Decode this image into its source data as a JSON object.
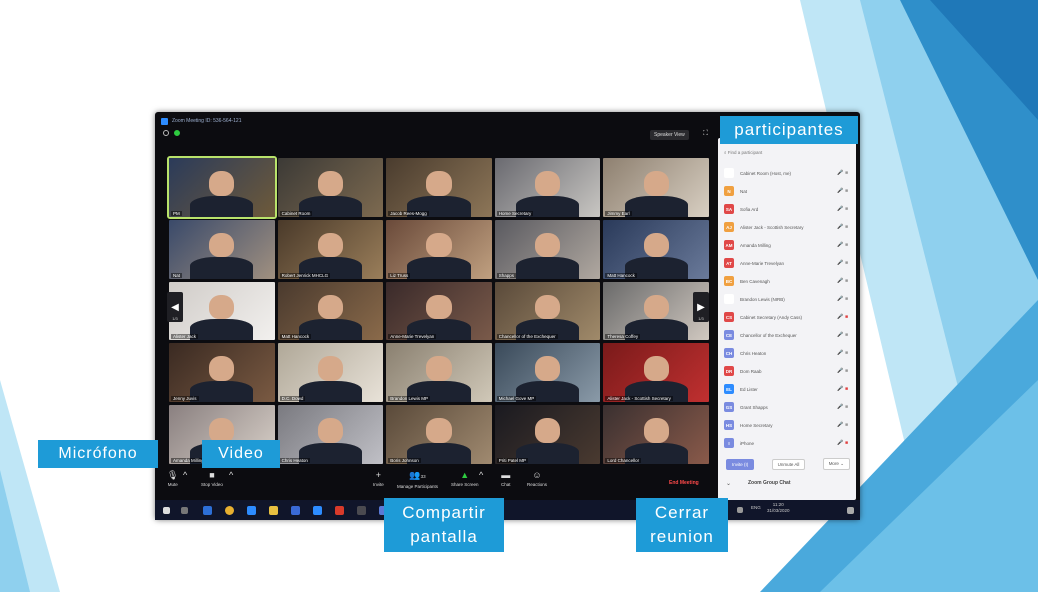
{
  "window": {
    "title": "Zoom Meeting ID: 536-564-121",
    "speaker_view_label": "Speaker View"
  },
  "grid": {
    "tiles": [
      {
        "name": "PM",
        "colors": [
          "#2b3b5a",
          "#6e5a3a"
        ]
      },
      {
        "name": "Cabinet Room",
        "colors": [
          "#3c3a36",
          "#7d6a50"
        ]
      },
      {
        "name": "Jacob Rees-Mogg",
        "colors": [
          "#4a3c2e",
          "#8d7658"
        ]
      },
      {
        "name": "Home Secretary",
        "colors": [
          "#6a6a70",
          "#c8c6c2"
        ]
      },
      {
        "name": "Jimmy Earl",
        "colors": [
          "#8e8070",
          "#d8cfc2"
        ]
      },
      {
        "name": "Nat",
        "colors": [
          "#3a4a6a",
          "#a09080"
        ]
      },
      {
        "name": "Robert Jenrick MHCLG",
        "colors": [
          "#4a3a2a",
          "#9a7e5a"
        ]
      },
      {
        "name": "Liz Truss",
        "colors": [
          "#6a4a3a",
          "#c0a080"
        ]
      },
      {
        "name": "Shapps",
        "colors": [
          "#5a5a60",
          "#b0a8a0"
        ]
      },
      {
        "name": "Matt Hancock",
        "colors": [
          "#2a3a5a",
          "#6a7a9a"
        ]
      },
      {
        "name": "Alister Jack",
        "colors": [
          "#d0ccc8",
          "#f2f0ee"
        ]
      },
      {
        "name": "Matt Hancock",
        "colors": [
          "#4a3a2e",
          "#8a6a4a"
        ]
      },
      {
        "name": "Anne-Marie Trevelyan",
        "colors": [
          "#3a2a2a",
          "#7a5a4a"
        ]
      },
      {
        "name": "Chancellor of the Exchequer",
        "colors": [
          "#5a4a3a",
          "#a08a6a"
        ]
      },
      {
        "name": "Theresa Coffey",
        "colors": [
          "#6a6a6a",
          "#d0c8c0"
        ]
      },
      {
        "name": "Jenny Juvis",
        "colors": [
          "#3a2a22",
          "#7a5a42"
        ]
      },
      {
        "name": "D.C. Dowd",
        "colors": [
          "#b0a898",
          "#e8e2d8"
        ]
      },
      {
        "name": "Brandon Lewis MP",
        "colors": [
          "#8a8070",
          "#d0c8b8"
        ]
      },
      {
        "name": "Michael Gove MP",
        "colors": [
          "#3a4a5a",
          "#8a9aa8"
        ]
      },
      {
        "name": "Alister Jack - Scottish Secretary",
        "colors": [
          "#7a1a1a",
          "#c03030"
        ]
      },
      {
        "name": "Amanda Milling",
        "colors": [
          "#8a8080",
          "#d8d0c8"
        ]
      },
      {
        "name": "Chris Heaton",
        "colors": [
          "#7a7a80",
          "#c0c0c6"
        ]
      },
      {
        "name": "Boris Johnson",
        "colors": [
          "#5a4a3a",
          "#a08a70"
        ]
      },
      {
        "name": "Priti Patel MP",
        "colors": [
          "#1a1a20",
          "#4a3a30"
        ]
      },
      {
        "name": "Lord Chancellor",
        "colors": [
          "#3a3030",
          "#8a5a4a"
        ]
      }
    ]
  },
  "nav": {
    "prev_page": "1/3",
    "next_page": "1/3"
  },
  "toolbar": {
    "mute": "Mute",
    "stop_video": "Stop Video",
    "invite": "Invite",
    "participants_count": "33",
    "manage_participants": "Manage Participants",
    "share_screen": "Share Screen",
    "chat": "Chat",
    "reactions": "Reactions",
    "end_meeting": "End Meeting"
  },
  "clock": {
    "time": "11:20",
    "date": "31/03/2020",
    "lang": "ENG"
  },
  "panel": {
    "search_placeholder": "Find a participant",
    "participants": [
      {
        "initials": "",
        "name": "Cabinet Room (Host, me)",
        "color": "#ffffff",
        "muted": false
      },
      {
        "initials": "N",
        "name": "Nat",
        "color": "#f0a040",
        "muted": false
      },
      {
        "initials": "SA",
        "name": "Sofia Ard",
        "color": "#e04848",
        "muted": false
      },
      {
        "initials": "AJ",
        "name": "Alister Jack - Scottish Secretary",
        "color": "#f0a040",
        "muted": false
      },
      {
        "initials": "AM",
        "name": "Amanda Milling",
        "color": "#e04848",
        "muted": false
      },
      {
        "initials": "AT",
        "name": "Anne-Marie Trevelyan",
        "color": "#e04848",
        "muted": false
      },
      {
        "initials": "BC",
        "name": "Ben Cavenagh",
        "color": "#f0a040",
        "muted": false
      },
      {
        "initials": "",
        "name": "Brandon Lewis (NIRB)",
        "color": "#ffffff",
        "muted": false
      },
      {
        "initials": "CS",
        "name": "Cabinet Secretary (Andy Cass)",
        "color": "#e04848",
        "muted": true
      },
      {
        "initials": "CE",
        "name": "Chancellor of the Exchequer",
        "color": "#7a8be0",
        "muted": false
      },
      {
        "initials": "CH",
        "name": "Chris Heaton",
        "color": "#7a8be0",
        "muted": false
      },
      {
        "initials": "DR",
        "name": "Dom Raab",
        "color": "#e04848",
        "muted": false
      },
      {
        "initials": "EL",
        "name": "Ed Lister",
        "color": "#2d8cff",
        "muted": true
      },
      {
        "initials": "GS",
        "name": "Grant Shapps",
        "color": "#7a8be0",
        "muted": false
      },
      {
        "initials": "HS",
        "name": "Home Secretary",
        "color": "#7a8be0",
        "muted": false
      },
      {
        "initials": "I",
        "name": "iPhone",
        "color": "#7a8be0",
        "muted": true
      }
    ],
    "invite_label": "Invite (I)",
    "unmute_all_label": "Unmute All",
    "more_label": "More",
    "group_chat": "Zoom Group Chat"
  },
  "labels": {
    "participantes": "participantes",
    "microfono": "Micrófono",
    "video": "Video",
    "compartir": [
      "Compartir",
      "pantalla"
    ],
    "cerrar": [
      "Cerrar",
      "reunion"
    ]
  },
  "theme": {
    "accent": "#1e9bd7",
    "zoom_blue": "#2d8cff",
    "end_red": "#ff4a4a"
  }
}
